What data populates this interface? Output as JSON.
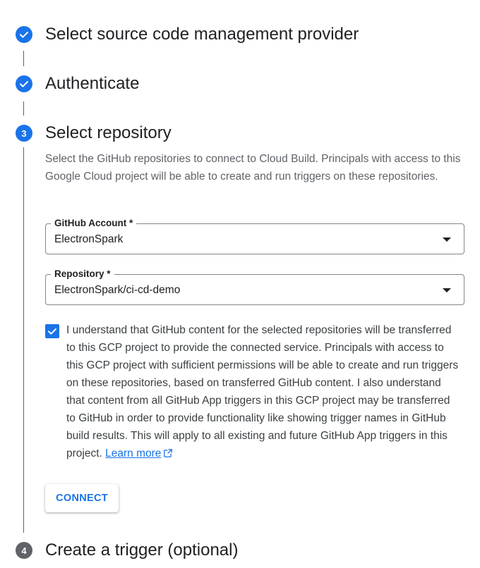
{
  "steps": [
    {
      "number": "1",
      "title": "Select source code management provider",
      "state": "done",
      "icon": "check-icon"
    },
    {
      "number": "2",
      "title": "Authenticate",
      "state": "done",
      "icon": "check-icon"
    },
    {
      "number": "3",
      "title": "Select repository",
      "state": "active"
    },
    {
      "number": "4",
      "title": "Create a trigger (optional)",
      "state": "inactive"
    }
  ],
  "select_repository": {
    "description": "Select the GitHub repositories to connect to Cloud Build. Principals with access to this Google Cloud project will be able to create and run triggers on these repositories.",
    "github_account": {
      "label": "GitHub Account *",
      "value": "ElectronSpark"
    },
    "repository": {
      "label": "Repository *",
      "value": "ElectronSpark/ci-cd-demo"
    },
    "consent": {
      "checked": true,
      "text": "I understand that GitHub content for the selected repositories will be transferred to this GCP project to provide the connected service. Principals with access to this GCP project with sufficient permissions will be able to create and run triggers on these repositories, based on transferred GitHub content. I also understand that content from all GitHub App triggers in this GCP project may be transferred to GitHub in order to provide functionality like showing trigger names in GitHub build results. This will apply to all existing and future GitHub App triggers in this project.",
      "link_label": "Learn more",
      "link_icon": "open-in-new-icon"
    },
    "connect_label": "CONNECT"
  },
  "colors": {
    "accent": "#1a73e8",
    "inactive_step": "#5f6368",
    "text": "#202124",
    "secondary_text": "#5f6368"
  }
}
